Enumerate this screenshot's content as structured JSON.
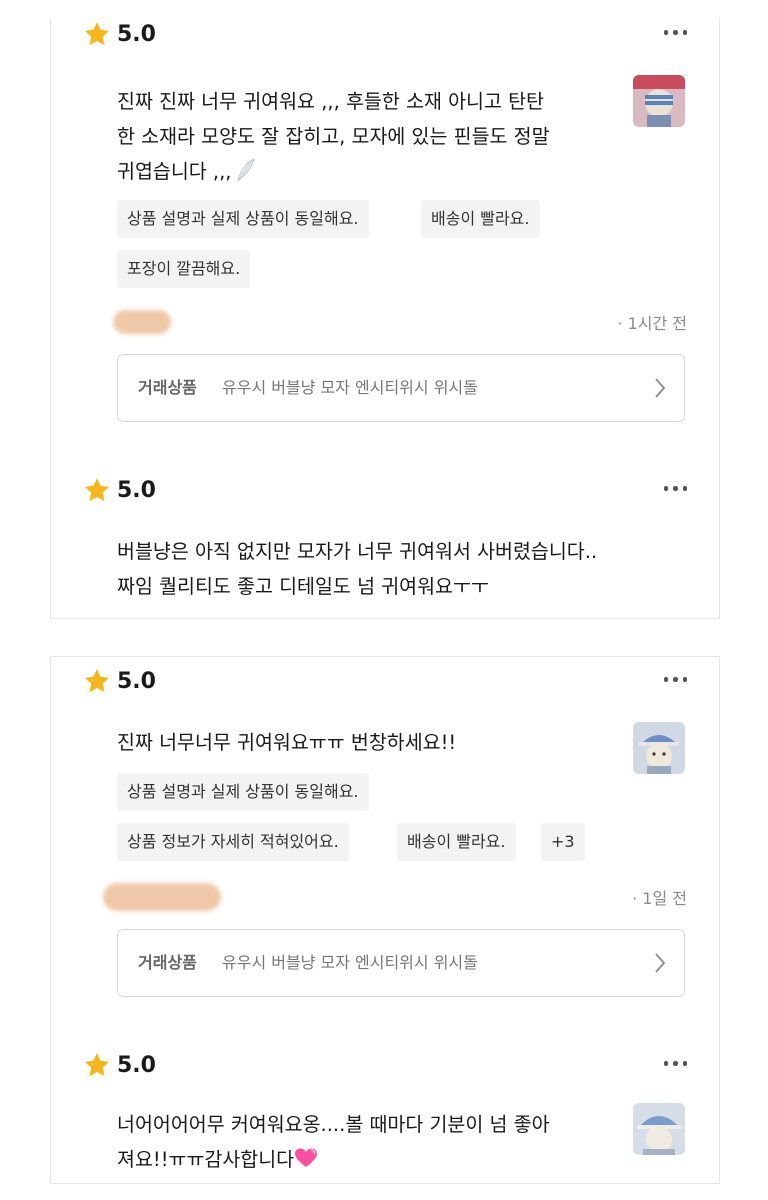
{
  "rating_icon": "star-icon",
  "more_icon": "more-horizontal-icon",
  "product_label": "거래상품",
  "product_name": "유우시 버블냥 모자 엔시티위시 위시돌",
  "colors": {
    "star": "#f5b71b",
    "tag_bg": "#f3f3f3",
    "redacted": "#efc8a8",
    "heart": "#ff4fa0"
  },
  "reviews": [
    {
      "score": "5.0",
      "lines": [
        "진짜 진짜 너무 귀여워요 ,,, 후들한 소재 아니고 탄탄",
        "한 소재라 모양도 잘 잡히고, 모자에 있는 핀들도 정말",
        "귀엽습니다 ,,,"
      ],
      "emoji": "wing-icon",
      "tags": [
        "상품 설명과 실제 상품이 동일해요.",
        "배송이 빨라요.",
        "포장이 깔끔해요."
      ],
      "time": "· 1시간 전"
    },
    {
      "score": "5.0",
      "lines": [
        "버블냥은 아직 없지만 모자가 너무 귀여워서 사버렸습니다..",
        "짜임 퀄리티도 좋고 디테일도 넘 귀여워요ㅜㅜ"
      ]
    },
    {
      "score": "5.0",
      "lines": [
        "진짜 너무너무 귀여워요ㅠㅠ 번창하세요!!"
      ],
      "tags": [
        "상품 설명과 실제 상품이 동일해요.",
        "상품 정보가 자세히 적혀있어요.",
        "배송이 빨라요.",
        "+3"
      ],
      "time": "· 1일 전"
    },
    {
      "score": "5.0",
      "lines": [
        "너어어어어무 커여워요옹....볼 때마다 기분이 넘 좋아",
        "져요!!ㅠㅠ감사합니다"
      ],
      "emoji": "heart-icon"
    }
  ]
}
